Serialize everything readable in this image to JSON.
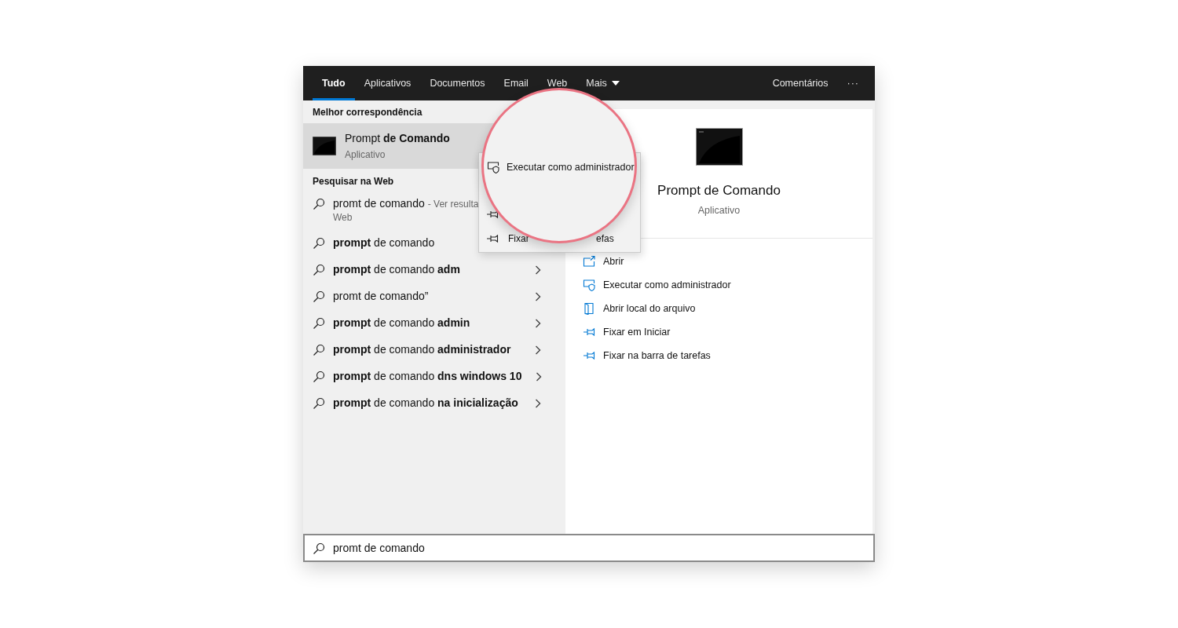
{
  "tabs": [
    {
      "label": "Tudo",
      "selected": true,
      "caret": false
    },
    {
      "label": "Aplicativos",
      "selected": false,
      "caret": false
    },
    {
      "label": "Documentos",
      "selected": false,
      "caret": false
    },
    {
      "label": "Email",
      "selected": false,
      "caret": false
    },
    {
      "label": "Web",
      "selected": false,
      "caret": false
    },
    {
      "label": "Mais",
      "selected": false,
      "caret": true
    }
  ],
  "header_actions": {
    "feedback": "Comentários",
    "more": "···"
  },
  "best_match": {
    "heading": "Melhor correspondência",
    "title": "Prompt **de Comando**",
    "subtitle": "Aplicativo",
    "selected": true
  },
  "web_search": {
    "heading": "Pesquisar na Web",
    "results": [
      {
        "text": "promt de comando",
        "suffix": "- Ver resulta",
        "second_line": "Web"
      },
      {
        "text": "**prompt** de comando"
      },
      {
        "text": "**prompt** de comando **adm**",
        "expandable": true
      },
      {
        "text": "promt de comando”",
        "expandable": true
      },
      {
        "text": "**prompt** de comando **admin**",
        "expandable": true
      },
      {
        "text": "**prompt** de comando **administrador**",
        "expandable": true
      },
      {
        "text": "**prompt** de comando **dns windows 10**",
        "expandable": true
      },
      {
        "text": "**prompt** de comando **na inicialização**",
        "expandable": true
      }
    ]
  },
  "context_menu": {
    "items": [
      {
        "kind": "pin"
      },
      {
        "kind": "pin",
        "label_start": "Fixar",
        "label_end": "efas"
      }
    ]
  },
  "magnifier": {
    "kind": "admin",
    "label": "Executar como administrador"
  },
  "preview": {
    "title": "Prompt de Comando",
    "subtitle": "Aplicativo",
    "actions": [
      {
        "kind": "open",
        "label": "Abrir"
      },
      {
        "kind": "admin",
        "label": "Executar como administrador"
      },
      {
        "kind": "folder",
        "label": "Abrir local do arquivo"
      },
      {
        "kind": "pin",
        "label": "Fixar em Iniciar"
      },
      {
        "kind": "pin",
        "label": "Fixar na barra de tarefas"
      }
    ]
  },
  "search": {
    "value": "promt de comando"
  }
}
